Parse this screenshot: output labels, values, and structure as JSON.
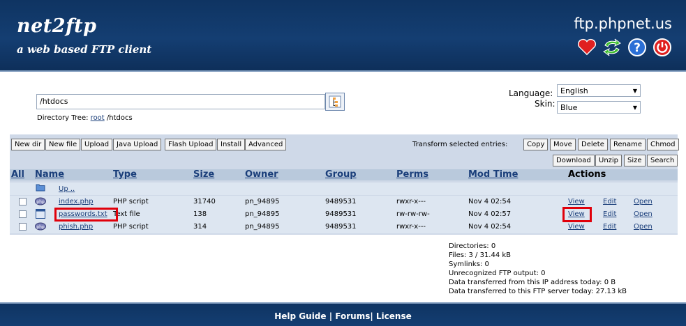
{
  "header": {
    "logo_text": "net2ftp",
    "tagline": "a web based FTP client",
    "server": "ftp.phpnet.us",
    "icons": [
      "bookmark-heart-icon",
      "refresh-icon",
      "help-icon",
      "logout-power-icon"
    ]
  },
  "path": {
    "value": "/htdocs",
    "tree_label": "Directory Tree:",
    "tree_root": "root",
    "tree_rest": "/htdocs"
  },
  "settings": {
    "language_label": "Language:",
    "language_value": "English",
    "skin_label": "Skin:",
    "skin_value": "Blue"
  },
  "toolbar": {
    "left": [
      "New dir",
      "New file",
      "Upload",
      "Java Upload",
      "Flash Upload",
      "Install",
      "Advanced"
    ],
    "transform_label": "Transform selected entries:",
    "right_row1": [
      "Copy",
      "Move",
      "Delete",
      "Rename",
      "Chmod"
    ],
    "right_row2": [
      "Download",
      "Unzip",
      "Size",
      "Search"
    ]
  },
  "table": {
    "headers": [
      "All",
      "Name",
      "Type",
      "Size",
      "Owner",
      "Group",
      "Perms",
      "Mod Time",
      "Actions"
    ],
    "up_label": "Up ..",
    "rows": [
      {
        "name": "index.php",
        "type": "PHP script",
        "size": "31740",
        "owner": "pn_94895",
        "group": "9489531",
        "perms": "rwxr-x---",
        "mtime": "Nov 4 02:54",
        "view": "View",
        "edit": "Edit",
        "open": "Open"
      },
      {
        "name": "passwords.txt",
        "type": "Text file",
        "size": "138",
        "owner": "pn_94895",
        "group": "9489531",
        "perms": "rw-rw-rw-",
        "mtime": "Nov 4 02:57",
        "view": "View",
        "edit": "Edit",
        "open": "Open"
      },
      {
        "name": "phish.php",
        "type": "PHP script",
        "size": "314",
        "owner": "pn_94895",
        "group": "9489531",
        "perms": "rwxr-x---",
        "mtime": "Nov 4 02:54",
        "view": "View",
        "edit": "Edit",
        "open": "Open"
      }
    ]
  },
  "stats": [
    "Directories: 0",
    "Files: 3 / 31.44 kB",
    "Symlinks: 0",
    "Unrecognized FTP output: 0",
    "Data transferred from this IP address today: 0 B",
    "Data transferred to this FTP server today: 27.13 kB"
  ],
  "footer": {
    "help": "Help Guide",
    "forums": "Forums",
    "license": "License"
  },
  "colors": {
    "header": "#143e72",
    "highlight": "#e0000b",
    "panel": "#cfd9e8",
    "row": "#dde6f1"
  }
}
